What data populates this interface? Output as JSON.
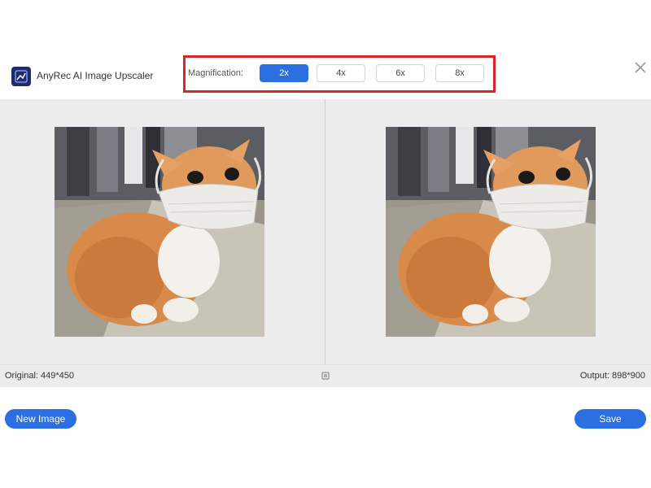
{
  "app": {
    "title": "AnyRec AI Image Upscaler",
    "logo_icon": "app-logo-icon"
  },
  "magnification": {
    "label": "Magnification:",
    "options": [
      "2x",
      "4x",
      "6x",
      "8x"
    ],
    "selected": "2x",
    "highlight_color": "#d9262c"
  },
  "preview": {
    "original_label": "Original: 449*450",
    "output_label": "Output: 898*900",
    "image_description_icon": "cat-photo"
  },
  "actions": {
    "new_image": "New Image",
    "save": "Save"
  },
  "colors": {
    "accent": "#2b6fe0",
    "panel_bg": "#ececec"
  }
}
